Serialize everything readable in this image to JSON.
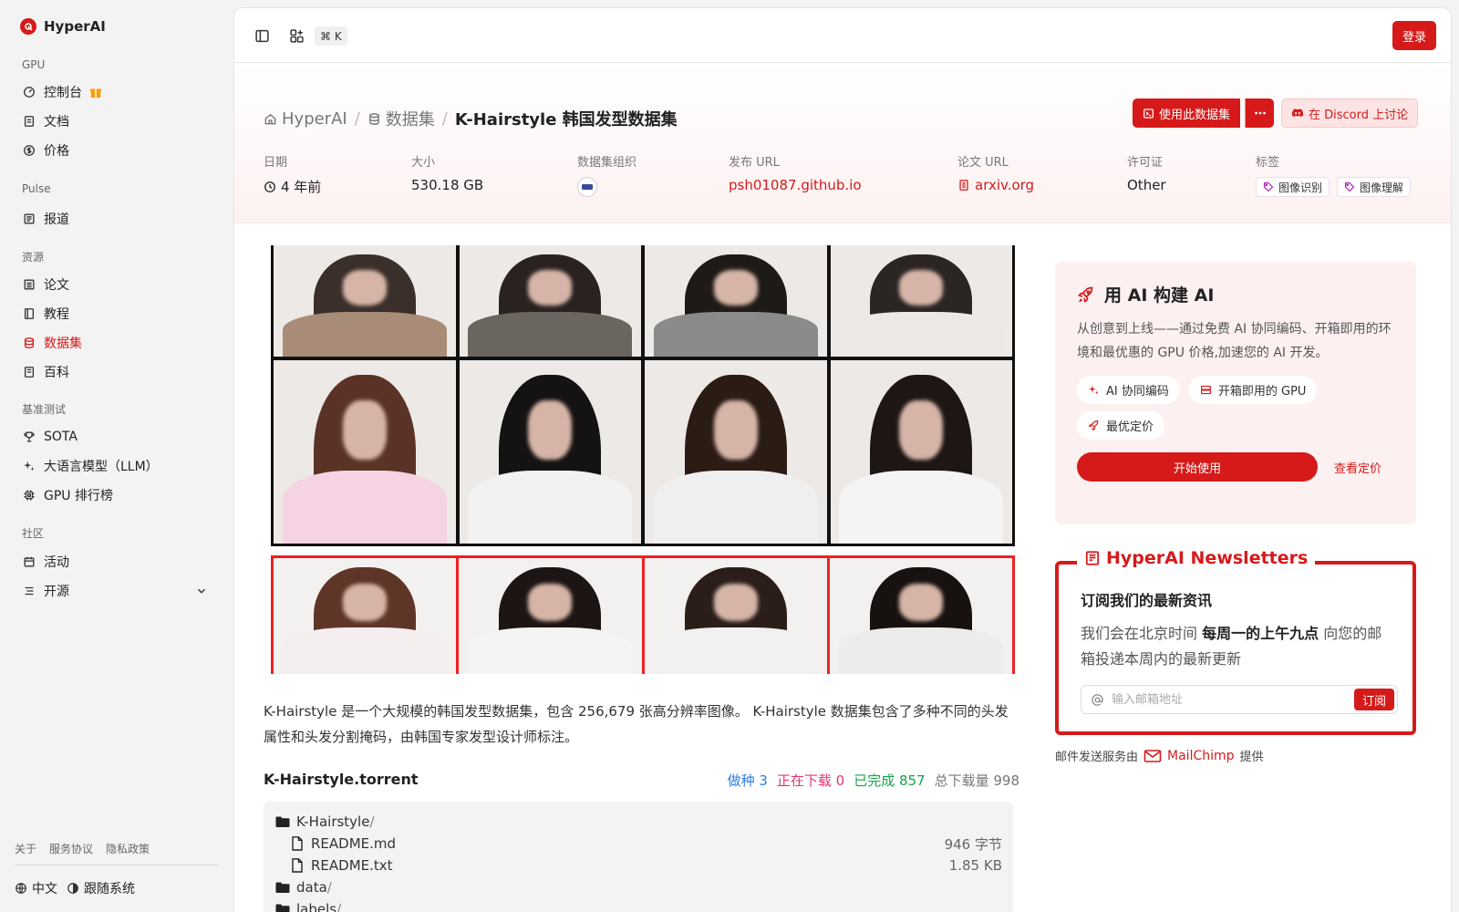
{
  "brand": {
    "name": "HyperAI"
  },
  "sidebar": {
    "sections": [
      {
        "label": "GPU",
        "items": [
          {
            "label": "控制台",
            "icon": "gauge-icon",
            "gift": true
          },
          {
            "label": "文档",
            "icon": "document-icon"
          },
          {
            "label": "价格",
            "icon": "dollar-icon"
          }
        ]
      },
      {
        "label": "Pulse",
        "items": [
          {
            "label": "报道",
            "icon": "news-icon"
          }
        ]
      },
      {
        "label": "资源",
        "items": [
          {
            "label": "论文",
            "icon": "paper-icon"
          },
          {
            "label": "教程",
            "icon": "tutorial-icon"
          },
          {
            "label": "数据集",
            "icon": "database-icon",
            "active": true
          },
          {
            "label": "百科",
            "icon": "encyclopedia-icon"
          }
        ]
      },
      {
        "label": "基准测试",
        "items": [
          {
            "label": "SOTA",
            "icon": "trophy-icon"
          },
          {
            "label": "大语言模型（LLM）",
            "icon": "sparkles-icon"
          },
          {
            "label": "GPU 排行榜",
            "icon": "cpu-icon"
          }
        ]
      },
      {
        "label": "社区",
        "items": [
          {
            "label": "活动",
            "icon": "calendar-icon"
          },
          {
            "label": "开源",
            "icon": "list-icon",
            "expandable": true
          }
        ]
      }
    ],
    "footer_links": [
      "关于",
      "服务协议",
      "隐私政策"
    ],
    "language": "中文",
    "theme": "跟随系统"
  },
  "topbar": {
    "shortcut": "⌘ K",
    "login_label": "登录"
  },
  "breadcrumb": {
    "home": "HyperAI",
    "section": "数据集",
    "current": "K-Hairstyle 韩国发型数据集"
  },
  "actions": {
    "use_dataset": "使用此数据集",
    "discord": "在 Discord 上讨论"
  },
  "meta": {
    "date": {
      "label": "日期",
      "value": "4 年前"
    },
    "size": {
      "label": "大小",
      "value": "530.18 GB"
    },
    "org": {
      "label": "数据集组织"
    },
    "release_url": {
      "label": "发布 URL",
      "value": "psh01087.github.io"
    },
    "paper_url": {
      "label": "论文 URL",
      "value": "arxiv.org"
    },
    "license": {
      "label": "许可证",
      "value": "Other"
    },
    "tags": {
      "label": "标签",
      "values": [
        "图像识别",
        "图像理解"
      ]
    }
  },
  "description": "K-Hairstyle 是一个大规模的韩国发型数据集，包含 256,679 张高分辨率图像。 K-Hairstyle 数据集包含了多种不同的头发属性和头发分割掩码，由韩国专家发型设计师标注。",
  "torrent": {
    "title": "K-Hairstyle.torrent",
    "seeding": "做种 3",
    "downloading": "正在下载 0",
    "completed": "已完成 857",
    "total_downloads": "总下载量 998",
    "files": [
      {
        "name": "K-Hairstyle",
        "type": "folder",
        "level": 0
      },
      {
        "name": "README.md",
        "type": "file",
        "level": 1,
        "size": "946 字节"
      },
      {
        "name": "README.txt",
        "type": "file",
        "level": 1,
        "size": "1.85 KB"
      },
      {
        "name": "data",
        "type": "folder",
        "level": 0
      },
      {
        "name": "labels",
        "type": "folder",
        "level": 0
      }
    ]
  },
  "promo": {
    "title": "用 AI 构建 AI",
    "description": "从创意到上线——通过免费 AI 协同编码、开箱即用的环境和最优惠的 GPU 价格,加速您的 AI 开发。",
    "chips": [
      "AI 协同编码",
      "开箱即用的 GPU",
      "最优定价"
    ],
    "start_label": "开始使用",
    "pricing_label": "查看定价"
  },
  "newsletter": {
    "legend": "HyperAI Newsletters",
    "title": "订阅我们的最新资讯",
    "desc_prefix": "我们会在北京时间 ",
    "desc_bold": "每周一的上午九点",
    "desc_suffix": " 向您的邮箱投递本周内的最新更新",
    "placeholder": "输入邮箱地址",
    "subscribe_label": "订阅"
  },
  "mail_credit": {
    "prefix": "邮件发送服务由",
    "provider": "MailChimp",
    "suffix": "提供"
  },
  "colors": {
    "accent": "#d61a1a",
    "seed": "#2b7de9",
    "downloading": "#e4356d",
    "completed": "#16a34a"
  }
}
